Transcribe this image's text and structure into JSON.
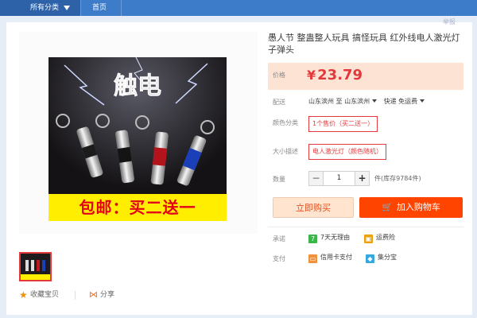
{
  "nav": {
    "all_categories": "所有分类",
    "home": "首页",
    "report": "举报"
  },
  "product": {
    "title": "愚人节 整蛊整人玩具 搞怪玩具 红外线电人激光灯 子弹头",
    "image_text": "触电",
    "promo_banner": "包邮：买二送一"
  },
  "price": {
    "label": "价格",
    "currency": "¥",
    "value": "23.79"
  },
  "shipping": {
    "label": "配送",
    "from": "山东滨州",
    "to_word": "至",
    "to": "山东滨州",
    "method": "快递 免运费"
  },
  "options": {
    "color_label": "颜色分类",
    "color_value": "1个售价（买二送一）",
    "size_label": "大小描述",
    "size_value": "电人激光灯（颜色随机）"
  },
  "quantity": {
    "label": "数量",
    "minus": "−",
    "value": "1",
    "plus": "+",
    "stock_text": "件(库存9784件)"
  },
  "buttons": {
    "buy_now": "立即购买",
    "add_to_cart": "加入购物车"
  },
  "promise": {
    "label": "承诺",
    "seven_days_icon": "7",
    "seven_days": "7天无理由",
    "insurance": "运费险"
  },
  "payment": {
    "label": "支付",
    "credit_card": "信用卡支付",
    "jifenbao": "集分宝"
  },
  "footer_actions": {
    "favorite": "收藏宝贝",
    "share": "分享"
  },
  "colors": {
    "nav_bg": "#3d7cc9",
    "accent_red": "#e4393c",
    "cart_orange": "#ff4400",
    "price_bg": "#fde3d3"
  }
}
